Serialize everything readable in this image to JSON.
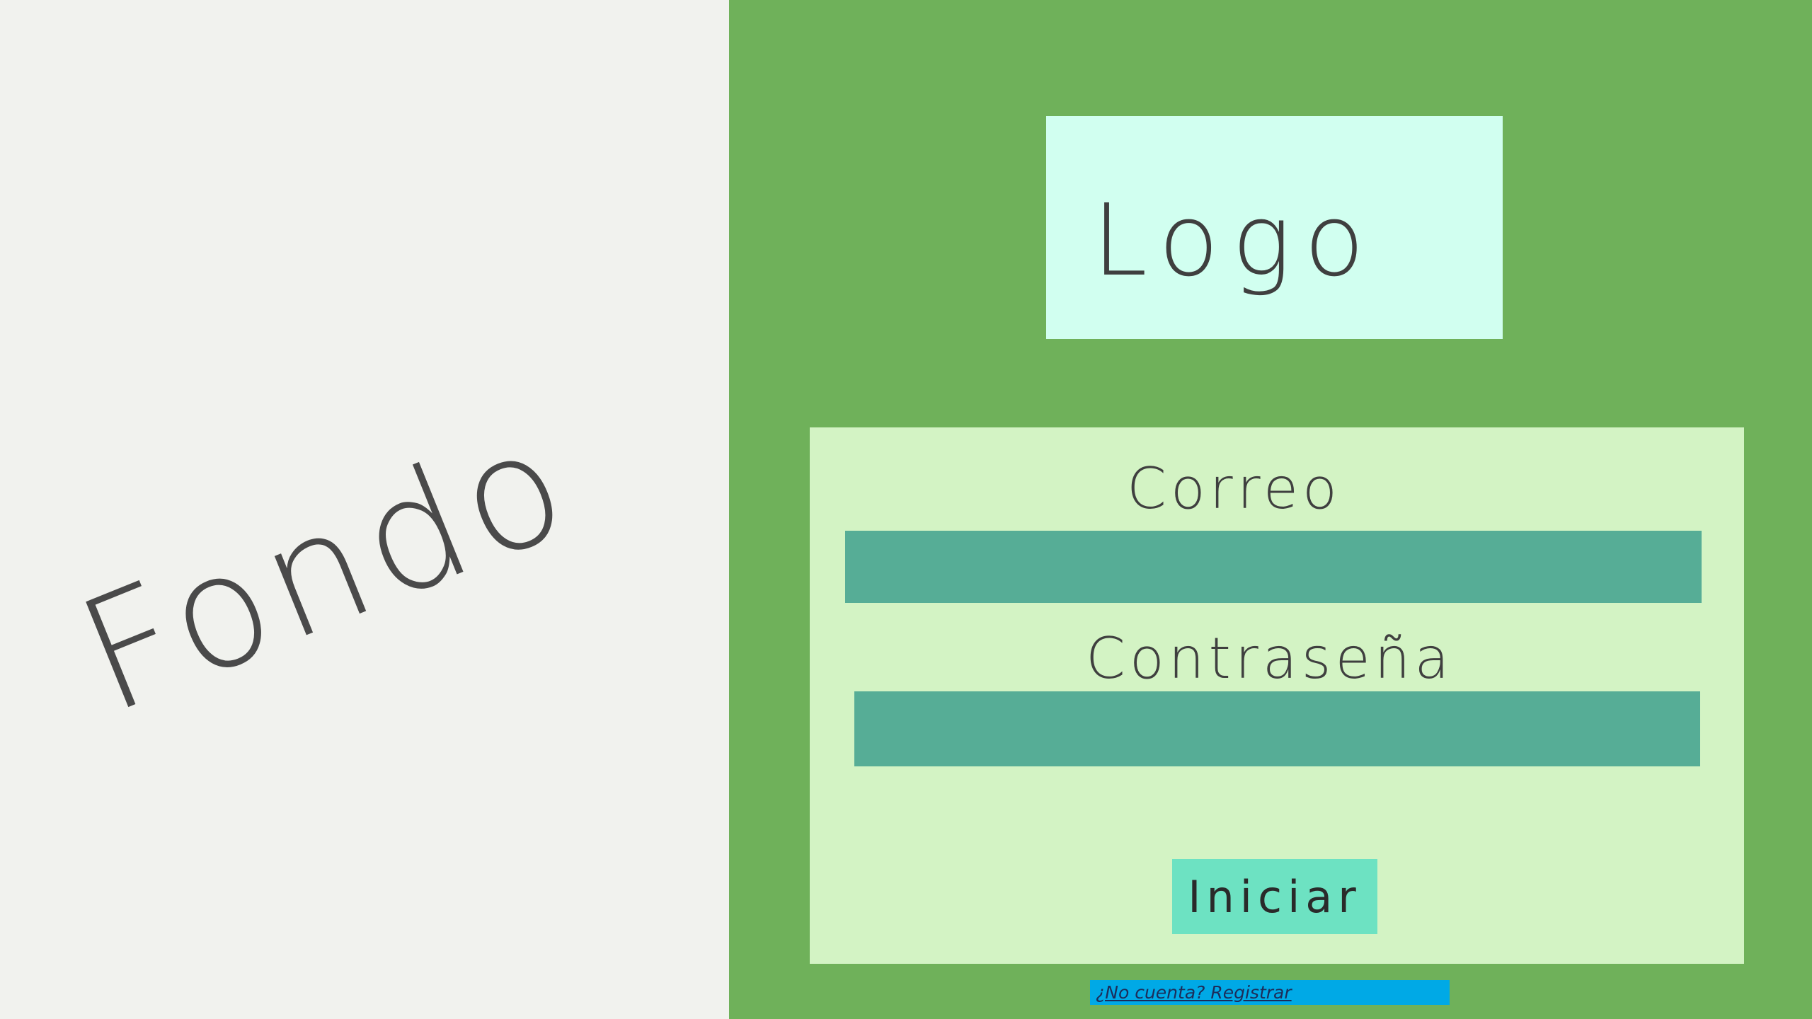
{
  "left_panel": {
    "background_label": "Fondo",
    "background_color": "#f1f2ee"
  },
  "right_panel": {
    "background_color": "#6fb15a",
    "logo": {
      "text": "Logo",
      "background_color": "#d1fff0"
    },
    "login_form": {
      "background_color": "#d3f3c4",
      "email_label": "Correo",
      "email_value": "",
      "password_label": "Contraseña",
      "password_value": "",
      "submit_label": "Iniciar",
      "input_color": "#56ad96",
      "button_color": "#6de2c2"
    },
    "register_link": {
      "text": "¿No cuenta? Registrar",
      "background_color": "#00a9e6"
    }
  }
}
